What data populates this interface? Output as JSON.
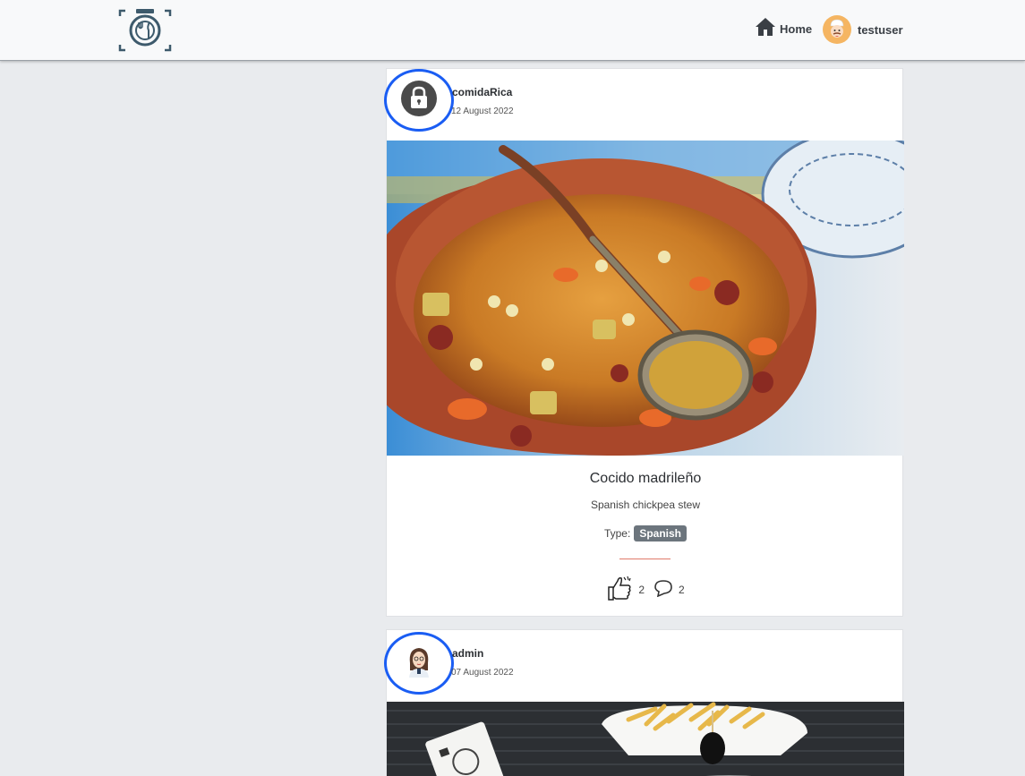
{
  "nav": {
    "logo_icon": "camera-plate-icon",
    "home_label": "Home",
    "home_icon": "house-icon",
    "user_label": "testuser",
    "user_avatar": "chef-avatar"
  },
  "posts": [
    {
      "username": "comidaRica",
      "date": "12 August 2022",
      "avatar_icon": "user-lock-icon",
      "image": "cocido-stew-photo",
      "title": "Cocido madrileño",
      "description": "Spanish chickpea stew",
      "type_label": "Type:",
      "type_value": "Spanish",
      "likes": "2",
      "comments": "2"
    },
    {
      "username": "admin",
      "date": "07 August 2022",
      "avatar_icon": "woman-avatar",
      "image": "fries-photo"
    }
  ],
  "colors": {
    "ring": "#1a5df3",
    "badge": "#6c757d",
    "divider": "#e07a6a"
  }
}
